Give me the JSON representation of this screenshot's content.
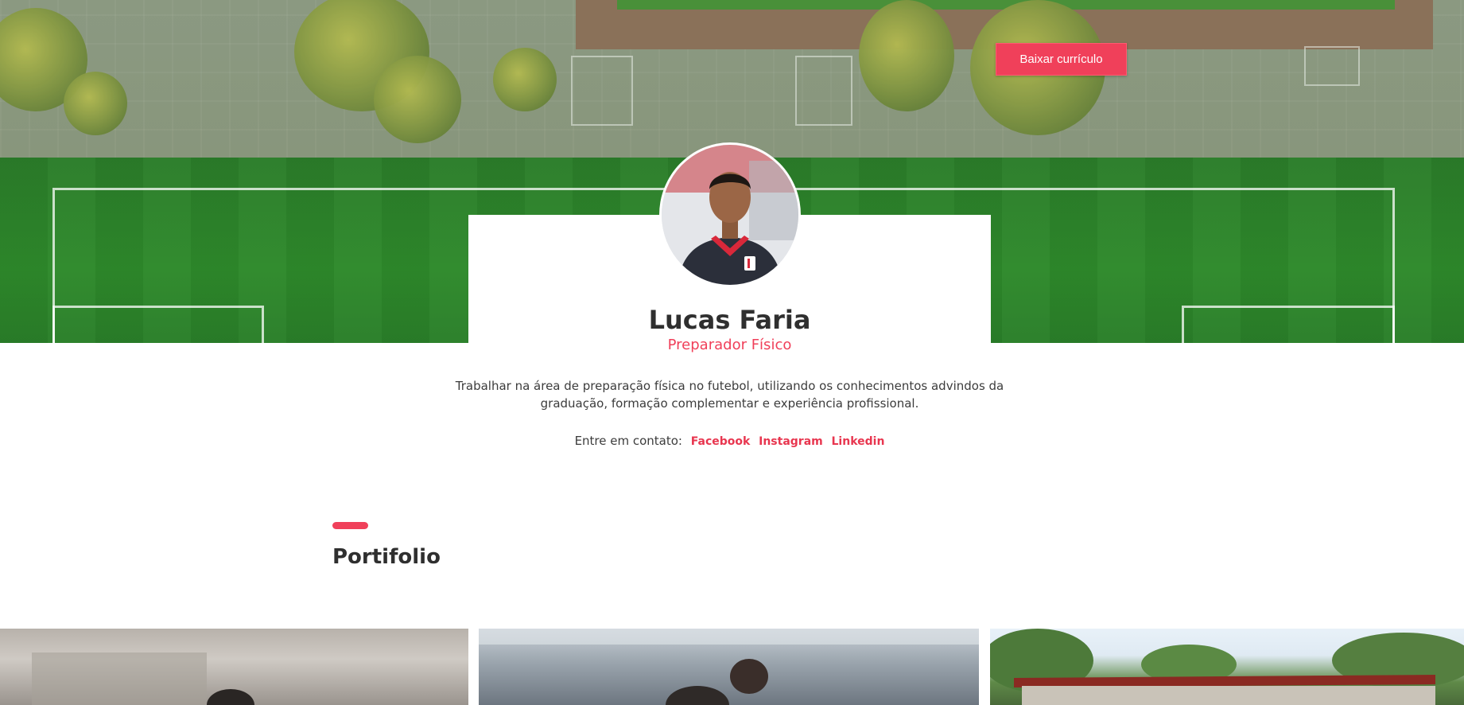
{
  "header": {
    "cv_button_label": "Baixar currículo"
  },
  "profile": {
    "name": "Lucas Faria",
    "role": "Preparador Físico",
    "bio": "Trabalhar na área de preparação física no futebol, utilizando os conhecimentos advindos da graduação, formação complementar e experiência profissional.",
    "contact_label": "Entre em contato:",
    "links": [
      {
        "label": "Facebook"
      },
      {
        "label": "Instagram"
      },
      {
        "label": "Linkedin"
      }
    ]
  },
  "portfolio": {
    "title": "Portifolio"
  },
  "colors": {
    "accent": "#f0405a",
    "field_green": "#2e8a2b",
    "text_dark": "#2f2f2f"
  }
}
